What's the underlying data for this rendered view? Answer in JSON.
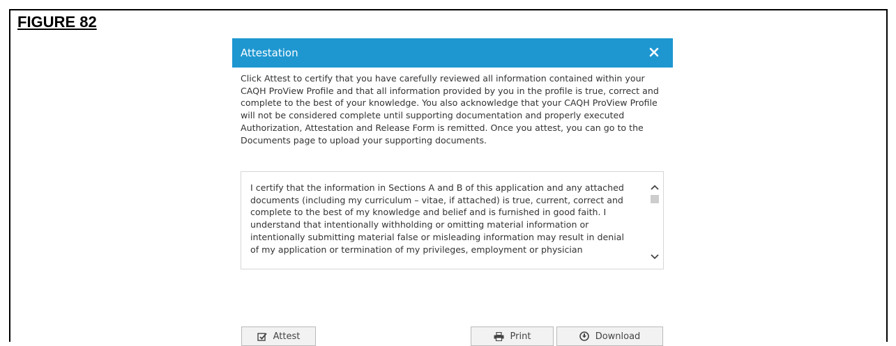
{
  "figure_label": "FIGURE 82",
  "dialog": {
    "title": "Attestation",
    "close_icon": "close-icon",
    "intro_text": "Click Attest to certify that you have carefully reviewed all information contained within your CAQH ProView Profile and that all information provided by you in the profile is true, correct and complete to the best of your knowledge. You also acknowledge that your CAQH ProView Profile will not be considered complete until supporting documentation and properly executed Authorization, Attestation and Release Form is remitted. Once you attest, you can go to the Documents page to upload your supporting documents.",
    "attestation_text": "I certify that the information in Sections A and B of this application and any attached documents (including my curriculum – vitae, if attached) is true, current, correct and complete to the best of my knowledge and belief and is furnished in good faith. I understand that intentionally withholding or omitting material information or intentionally submitting material false or misleading information may result in denial of my application or termination of my privileges, employment or physician"
  },
  "buttons": {
    "attest": {
      "label": "Attest",
      "icon": "checkbox-edit-icon"
    },
    "print": {
      "label": "Print",
      "icon": "printer-icon"
    },
    "download": {
      "label": "Download",
      "icon": "download-icon"
    }
  },
  "colors": {
    "header_bg": "#1e97d1",
    "header_text": "#ffffff",
    "button_bg": "#f2f2f2"
  }
}
